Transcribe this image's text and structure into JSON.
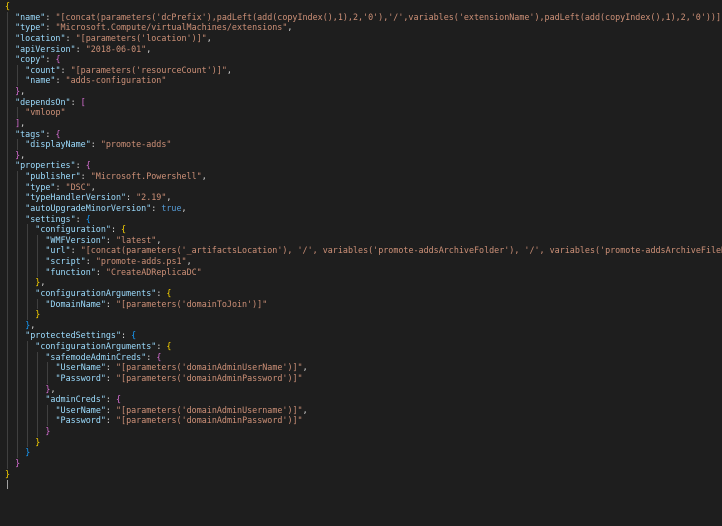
{
  "colors": {
    "background": "#1e1e1e",
    "key": "#9cdcfe",
    "string": "#ce9178",
    "punctuation": "#d4d4d4",
    "boolean": "#569cd6",
    "bracket_level_0": "#ffd700",
    "bracket_level_1": "#da70d6",
    "bracket_level_2": "#179fff",
    "indent_guide": "#404040"
  },
  "lines": [
    {
      "indent": 0,
      "tokens": [
        {
          "t": "br0",
          "v": "{"
        }
      ]
    },
    {
      "indent": 1,
      "tokens": [
        {
          "t": "key",
          "v": "\"name\""
        },
        {
          "t": "punct",
          "v": ": "
        },
        {
          "t": "str",
          "v": "\"[concat(parameters('dcPrefix'),padLeft(add(copyIndex(),1),2,'0'),'/',variables('extensionName'),padLeft(add(copyIndex(),1),2,'0'))]\""
        },
        {
          "t": "punct",
          "v": ","
        }
      ]
    },
    {
      "indent": 1,
      "tokens": [
        {
          "t": "key",
          "v": "\"type\""
        },
        {
          "t": "punct",
          "v": ": "
        },
        {
          "t": "str",
          "v": "\"Microsoft.Compute/virtualMachines/extensions\""
        },
        {
          "t": "punct",
          "v": ","
        }
      ]
    },
    {
      "indent": 1,
      "tokens": [
        {
          "t": "key",
          "v": "\"location\""
        },
        {
          "t": "punct",
          "v": ": "
        },
        {
          "t": "str",
          "v": "\"[parameters('location')]\""
        },
        {
          "t": "punct",
          "v": ","
        }
      ]
    },
    {
      "indent": 1,
      "tokens": [
        {
          "t": "key",
          "v": "\"apiVersion\""
        },
        {
          "t": "punct",
          "v": ": "
        },
        {
          "t": "str",
          "v": "\"2018-06-01\""
        },
        {
          "t": "punct",
          "v": ","
        }
      ]
    },
    {
      "indent": 1,
      "tokens": [
        {
          "t": "key",
          "v": "\"copy\""
        },
        {
          "t": "punct",
          "v": ": "
        },
        {
          "t": "br1",
          "v": "{"
        }
      ]
    },
    {
      "indent": 2,
      "tokens": [
        {
          "t": "key",
          "v": "\"count\""
        },
        {
          "t": "punct",
          "v": ": "
        },
        {
          "t": "str",
          "v": "\"[parameters('resourceCount')]\""
        },
        {
          "t": "punct",
          "v": ","
        }
      ]
    },
    {
      "indent": 2,
      "tokens": [
        {
          "t": "key",
          "v": "\"name\""
        },
        {
          "t": "punct",
          "v": ": "
        },
        {
          "t": "str",
          "v": "\"adds-configuration\""
        }
      ]
    },
    {
      "indent": 1,
      "tokens": [
        {
          "t": "br1",
          "v": "}"
        },
        {
          "t": "punct",
          "v": ","
        }
      ]
    },
    {
      "indent": 1,
      "tokens": [
        {
          "t": "key",
          "v": "\"dependsOn\""
        },
        {
          "t": "punct",
          "v": ": "
        },
        {
          "t": "br1",
          "v": "["
        }
      ]
    },
    {
      "indent": 2,
      "tokens": [
        {
          "t": "str",
          "v": "\"vmloop\""
        }
      ]
    },
    {
      "indent": 1,
      "tokens": [
        {
          "t": "br1",
          "v": "]"
        },
        {
          "t": "punct",
          "v": ","
        }
      ]
    },
    {
      "indent": 1,
      "tokens": [
        {
          "t": "key",
          "v": "\"tags\""
        },
        {
          "t": "punct",
          "v": ": "
        },
        {
          "t": "br1",
          "v": "{"
        }
      ]
    },
    {
      "indent": 2,
      "tokens": [
        {
          "t": "key",
          "v": "\"displayName\""
        },
        {
          "t": "punct",
          "v": ": "
        },
        {
          "t": "str",
          "v": "\"promote-adds\""
        }
      ]
    },
    {
      "indent": 1,
      "tokens": [
        {
          "t": "br1",
          "v": "}"
        },
        {
          "t": "punct",
          "v": ","
        }
      ]
    },
    {
      "indent": 1,
      "tokens": [
        {
          "t": "key",
          "v": "\"properties\""
        },
        {
          "t": "punct",
          "v": ": "
        },
        {
          "t": "br1",
          "v": "{"
        }
      ]
    },
    {
      "indent": 2,
      "tokens": [
        {
          "t": "key",
          "v": "\"publisher\""
        },
        {
          "t": "punct",
          "v": ": "
        },
        {
          "t": "str",
          "v": "\"Microsoft.Powershell\""
        },
        {
          "t": "punct",
          "v": ","
        }
      ]
    },
    {
      "indent": 2,
      "tokens": [
        {
          "t": "key",
          "v": "\"type\""
        },
        {
          "t": "punct",
          "v": ": "
        },
        {
          "t": "str",
          "v": "\"DSC\""
        },
        {
          "t": "punct",
          "v": ","
        }
      ]
    },
    {
      "indent": 2,
      "tokens": [
        {
          "t": "key",
          "v": "\"typeHandlerVersion\""
        },
        {
          "t": "punct",
          "v": ": "
        },
        {
          "t": "str",
          "v": "\"2.19\""
        },
        {
          "t": "punct",
          "v": ","
        }
      ]
    },
    {
      "indent": 2,
      "tokens": [
        {
          "t": "key",
          "v": "\"autoUpgradeMinorVersion\""
        },
        {
          "t": "punct",
          "v": ": "
        },
        {
          "t": "bool",
          "v": "true"
        },
        {
          "t": "punct",
          "v": ","
        }
      ]
    },
    {
      "indent": 2,
      "tokens": [
        {
          "t": "key",
          "v": "\"settings\""
        },
        {
          "t": "punct",
          "v": ": "
        },
        {
          "t": "br2",
          "v": "{"
        }
      ]
    },
    {
      "indent": 3,
      "tokens": [
        {
          "t": "key",
          "v": "\"configuration\""
        },
        {
          "t": "punct",
          "v": ": "
        },
        {
          "t": "br0",
          "v": "{"
        }
      ]
    },
    {
      "indent": 4,
      "tokens": [
        {
          "t": "key",
          "v": "\"WMFVersion\""
        },
        {
          "t": "punct",
          "v": ": "
        },
        {
          "t": "str",
          "v": "\"latest\""
        },
        {
          "t": "punct",
          "v": ","
        }
      ]
    },
    {
      "indent": 4,
      "tokens": [
        {
          "t": "key",
          "v": "\"url\""
        },
        {
          "t": "punct",
          "v": ": "
        },
        {
          "t": "str",
          "v": "\"[concat(parameters('_artifactsLocation'), '/', variables('promote-addsArchiveFolder'), '/', variables('promote-addsArchiveFileName'))]\""
        },
        {
          "t": "punct",
          "v": ","
        }
      ]
    },
    {
      "indent": 4,
      "tokens": [
        {
          "t": "key",
          "v": "\"script\""
        },
        {
          "t": "punct",
          "v": ": "
        },
        {
          "t": "str",
          "v": "\"promote-adds.ps1\""
        },
        {
          "t": "punct",
          "v": ","
        }
      ]
    },
    {
      "indent": 4,
      "tokens": [
        {
          "t": "key",
          "v": "\"function\""
        },
        {
          "t": "punct",
          "v": ": "
        },
        {
          "t": "str",
          "v": "\"CreateADReplicaDC\""
        }
      ]
    },
    {
      "indent": 3,
      "tokens": [
        {
          "t": "br0",
          "v": "}"
        },
        {
          "t": "punct",
          "v": ","
        }
      ]
    },
    {
      "indent": 3,
      "tokens": [
        {
          "t": "key",
          "v": "\"configurationArguments\""
        },
        {
          "t": "punct",
          "v": ": "
        },
        {
          "t": "br0",
          "v": "{"
        }
      ]
    },
    {
      "indent": 4,
      "tokens": [
        {
          "t": "key",
          "v": "\"DomainName\""
        },
        {
          "t": "punct",
          "v": ": "
        },
        {
          "t": "str",
          "v": "\"[parameters('domainToJoin')]\""
        }
      ]
    },
    {
      "indent": 3,
      "tokens": [
        {
          "t": "br0",
          "v": "}"
        }
      ]
    },
    {
      "indent": 2,
      "tokens": [
        {
          "t": "br2",
          "v": "}"
        },
        {
          "t": "punct",
          "v": ","
        }
      ]
    },
    {
      "indent": 2,
      "tokens": [
        {
          "t": "key",
          "v": "\"protectedSettings\""
        },
        {
          "t": "punct",
          "v": ": "
        },
        {
          "t": "br2",
          "v": "{"
        }
      ]
    },
    {
      "indent": 3,
      "tokens": [
        {
          "t": "key",
          "v": "\"configurationArguments\""
        },
        {
          "t": "punct",
          "v": ": "
        },
        {
          "t": "br0",
          "v": "{"
        }
      ]
    },
    {
      "indent": 4,
      "tokens": [
        {
          "t": "key",
          "v": "\"safemodeAdminCreds\""
        },
        {
          "t": "punct",
          "v": ": "
        },
        {
          "t": "br1",
          "v": "{"
        }
      ]
    },
    {
      "indent": 5,
      "tokens": [
        {
          "t": "key",
          "v": "\"UserName\""
        },
        {
          "t": "punct",
          "v": ": "
        },
        {
          "t": "str",
          "v": "\"[parameters('domainAdminUserName')]\""
        },
        {
          "t": "punct",
          "v": ","
        }
      ]
    },
    {
      "indent": 5,
      "tokens": [
        {
          "t": "key",
          "v": "\"Password\""
        },
        {
          "t": "punct",
          "v": ": "
        },
        {
          "t": "str",
          "v": "\"[parameters('domainAdminPassword')]\""
        }
      ]
    },
    {
      "indent": 4,
      "tokens": [
        {
          "t": "br1",
          "v": "}"
        },
        {
          "t": "punct",
          "v": ","
        }
      ]
    },
    {
      "indent": 4,
      "tokens": [
        {
          "t": "key",
          "v": "\"adminCreds\""
        },
        {
          "t": "punct",
          "v": ": "
        },
        {
          "t": "br1",
          "v": "{"
        }
      ]
    },
    {
      "indent": 5,
      "tokens": [
        {
          "t": "key",
          "v": "\"UserName\""
        },
        {
          "t": "punct",
          "v": ": "
        },
        {
          "t": "str",
          "v": "\"[parameters('domainAdminUsername')]\""
        },
        {
          "t": "punct",
          "v": ","
        }
      ]
    },
    {
      "indent": 5,
      "tokens": [
        {
          "t": "key",
          "v": "\"Password\""
        },
        {
          "t": "punct",
          "v": ": "
        },
        {
          "t": "str",
          "v": "\"[parameters('domainAdminPassword')]\""
        }
      ]
    },
    {
      "indent": 4,
      "tokens": [
        {
          "t": "br1",
          "v": "}"
        }
      ]
    },
    {
      "indent": 3,
      "tokens": [
        {
          "t": "br0",
          "v": "}"
        }
      ]
    },
    {
      "indent": 2,
      "tokens": [
        {
          "t": "br2",
          "v": "}"
        }
      ]
    },
    {
      "indent": 1,
      "tokens": [
        {
          "t": "br1",
          "v": "}"
        }
      ]
    },
    {
      "indent": 0,
      "tokens": [
        {
          "t": "br0",
          "v": "}"
        }
      ]
    },
    {
      "indent": 0,
      "tokens": [
        {
          "t": "punct",
          "v": "|"
        }
      ]
    }
  ]
}
